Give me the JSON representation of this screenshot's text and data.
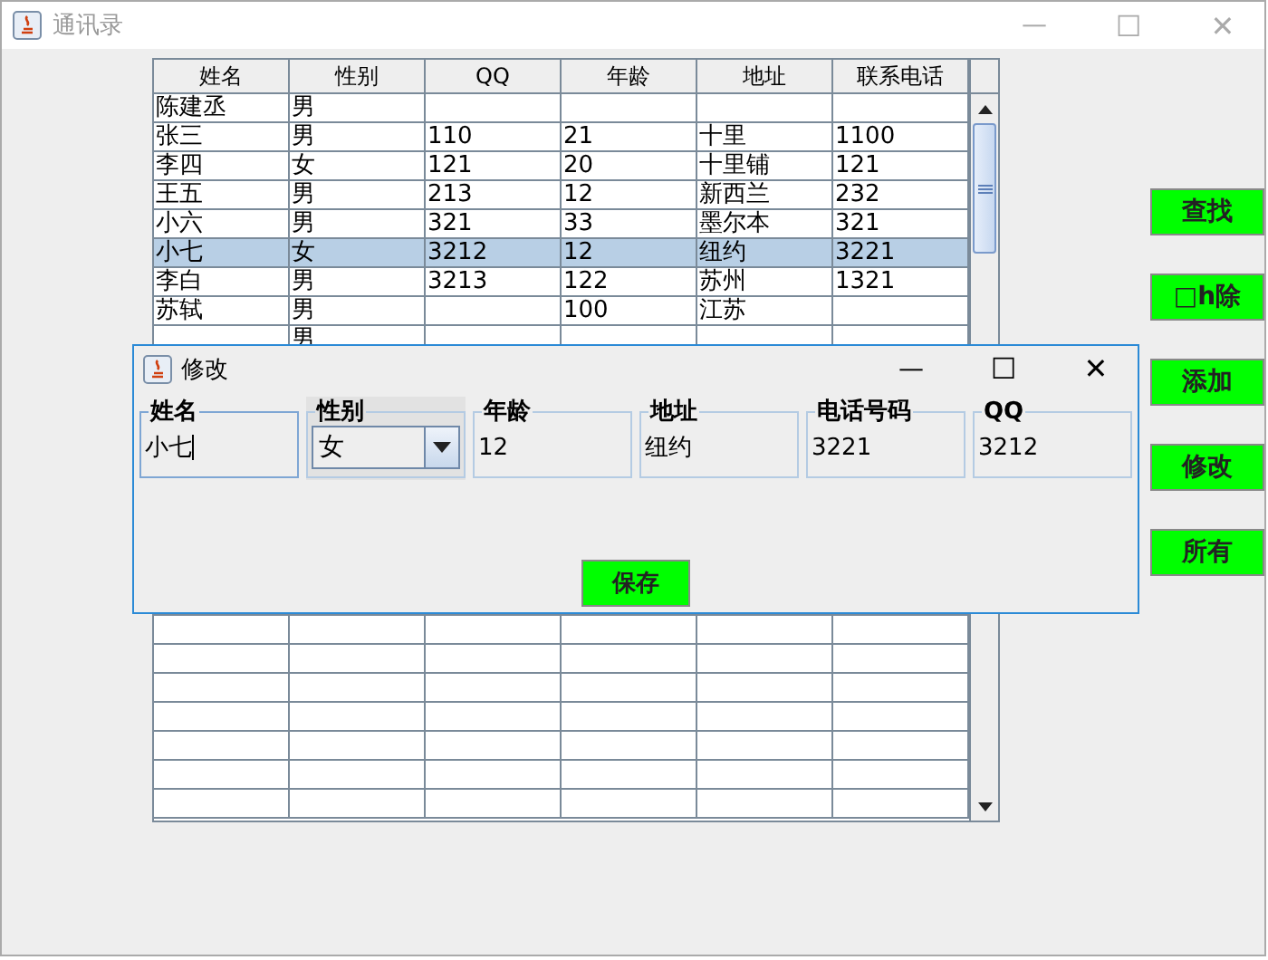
{
  "window": {
    "title": "通讯录",
    "controls": [
      "—",
      "☐",
      "✕"
    ]
  },
  "table": {
    "columns": [
      "姓名",
      "性别",
      "QQ",
      "年龄",
      "地址",
      "联系电话"
    ],
    "rows": [
      {
        "cells": [
          "陈建丞",
          "男",
          "",
          "",
          "",
          ""
        ],
        "selected": false
      },
      {
        "cells": [
          "张三",
          "男",
          "110",
          "21",
          "十里",
          "1100"
        ],
        "selected": false
      },
      {
        "cells": [
          "李四",
          "女",
          "121",
          "20",
          "十里铺",
          "121"
        ],
        "selected": false
      },
      {
        "cells": [
          "王五",
          "男",
          "213",
          "12",
          "新西兰",
          "232"
        ],
        "selected": false
      },
      {
        "cells": [
          "小六",
          "男",
          "321",
          "33",
          "墨尔本",
          "321"
        ],
        "selected": false
      },
      {
        "cells": [
          "小七",
          "女",
          "3212",
          "12",
          "纽约",
          "3221"
        ],
        "selected": true
      },
      {
        "cells": [
          "李白",
          "男",
          "3213",
          "122",
          "苏州",
          "1321"
        ],
        "selected": false
      },
      {
        "cells": [
          "苏轼",
          "男",
          "",
          "100",
          "江苏",
          ""
        ],
        "selected": false
      },
      {
        "cells": [
          "",
          "男",
          "",
          "",
          "",
          ""
        ],
        "selected": false
      }
    ]
  },
  "side_buttons": [
    "查找",
    "□h除",
    "添加",
    "修改",
    "所有"
  ],
  "dialog": {
    "title": "修改",
    "controls": [
      "—",
      "☐",
      "✕"
    ],
    "fields": [
      {
        "label": "姓名",
        "kind": "text",
        "value": "小七",
        "focused": true
      },
      {
        "label": "性别",
        "kind": "combo",
        "value": "女",
        "focused": false
      },
      {
        "label": "年龄",
        "kind": "text",
        "value": "12",
        "focused": false
      },
      {
        "label": "地址",
        "kind": "text",
        "value": "纽约",
        "focused": false
      },
      {
        "label": "电话号码",
        "kind": "text",
        "value": "3221",
        "focused": false
      },
      {
        "label": "QQ",
        "kind": "text",
        "value": "3212",
        "focused": false
      }
    ],
    "save_button": "保存"
  }
}
